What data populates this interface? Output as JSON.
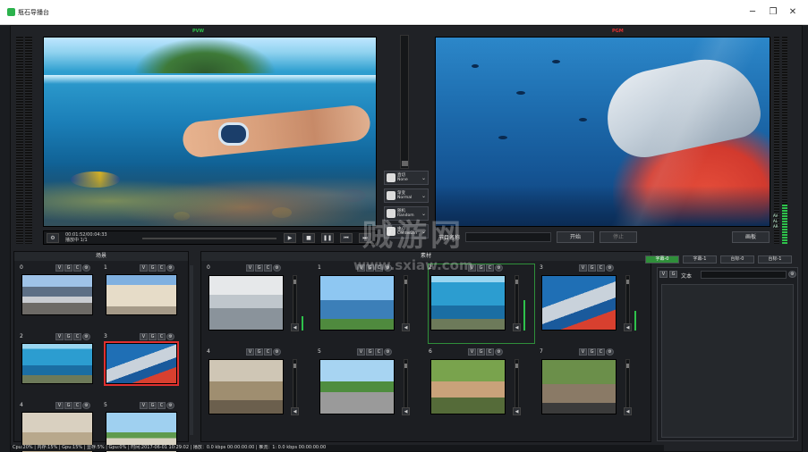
{
  "window": {
    "title": "瓶石导播台",
    "buttons": {
      "minimize": "─",
      "maximize": "❐",
      "close": "✕"
    }
  },
  "monitors": {
    "preview_label": "PVW",
    "program_label": "PGM"
  },
  "transport": {
    "time": "00:01:52/00:04:33",
    "playlist": "播放中 1/1",
    "buttons": {
      "play": "▶",
      "stop": "■",
      "pause": "❚❚",
      "prev": "⏮",
      "next": "⏭"
    }
  },
  "transitions": [
    {
      "name": "直切",
      "sub": "None"
    },
    {
      "name": "渐变",
      "sub": "Normal"
    },
    {
      "name": "随机",
      "sub": "Random"
    },
    {
      "name": "中心",
      "sub": "Center2in"
    }
  ],
  "program_controls": {
    "name_label": "节目名称",
    "start": "开始",
    "stop": "停止",
    "fullscreen": "画板"
  },
  "audio_meter_labels": [
    "AV",
    "AL",
    "AR"
  ],
  "scenes_panel": {
    "title": "场景",
    "scenes": [
      {
        "num": "0",
        "tag": "train",
        "selected": false
      },
      {
        "num": "1",
        "tag": "building",
        "selected": false
      },
      {
        "num": "2",
        "tag": "diver",
        "selected": false
      },
      {
        "num": "3",
        "tag": "dolphin",
        "selected": true
      },
      {
        "num": "4",
        "tag": "library",
        "selected": false
      },
      {
        "num": "5",
        "tag": "palm",
        "selected": false
      }
    ],
    "mini_buttons": {
      "v": "V",
      "g": "G",
      "c": "C"
    }
  },
  "materials_panel": {
    "title": "素材",
    "items": [
      {
        "num": "0",
        "tag": "office",
        "level": 0.25,
        "active": false
      },
      {
        "num": "1",
        "tag": "lake",
        "level": 0.0,
        "active": false
      },
      {
        "num": "2",
        "tag": "diver",
        "level": 0.55,
        "active": true
      },
      {
        "num": "3",
        "tag": "dolphin",
        "level": 0.35,
        "active": false
      },
      {
        "num": "4",
        "tag": "warehouse",
        "level": 0.0,
        "active": false
      },
      {
        "num": "5",
        "tag": "palm-street",
        "level": 0.0,
        "active": false
      },
      {
        "num": "6",
        "tag": "camping",
        "level": 0.0,
        "active": false
      },
      {
        "num": "7",
        "tag": "cyclist",
        "level": 0.0,
        "active": false
      }
    ]
  },
  "subtitle_panel": {
    "tabs": [
      {
        "label": "字幕-0",
        "active": true
      },
      {
        "label": "字幕-1",
        "active": false
      },
      {
        "label": "台标-0",
        "active": false
      },
      {
        "label": "台标-1",
        "active": false
      }
    ],
    "text_label": "文本"
  },
  "status_bar": "Cpu:20% | 内存:15% | Gpu:15% | 显存:5% | Gpu:0% | 时间:2017-06-01 10:29:02 | 播放：0.0 kbps 00:00:00:00 | 推流：1: 0.0 kbps 00:00:00:00",
  "watermark": {
    "main": "贼游网",
    "url": "www.sxiaw.com"
  },
  "colors": {
    "accent_green": "#2f8f3a",
    "selection_red": "#e03030",
    "background": "#202226"
  }
}
